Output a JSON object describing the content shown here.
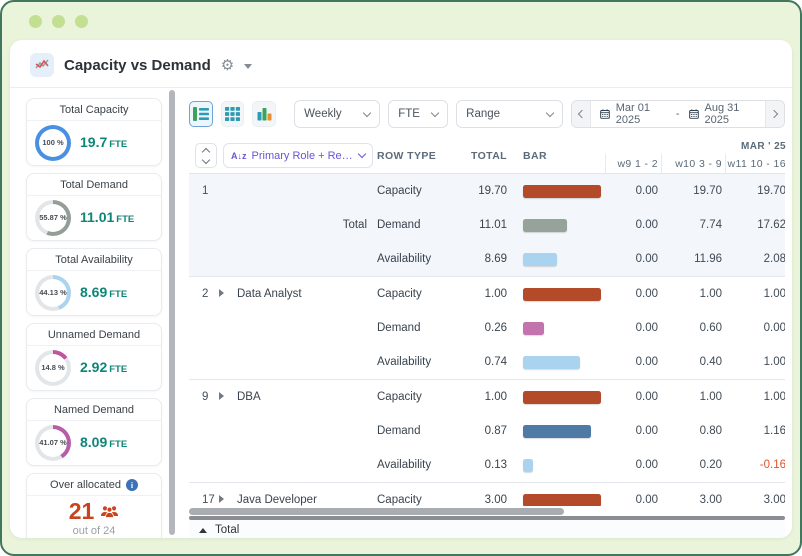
{
  "window": {
    "title": "Capacity vs Demand"
  },
  "sidebar": {
    "cards": [
      {
        "label": "Total Capacity",
        "pct": "100 %",
        "pct_value": 100,
        "value": "19.7",
        "unit": "FTE",
        "ring_color": "#4a90e2"
      },
      {
        "label": "Total Demand",
        "pct": "55.87 %",
        "pct_value": 55.87,
        "value": "11.01",
        "unit": "FTE",
        "ring_color": "#939e97"
      },
      {
        "label": "Total Availability",
        "pct": "44.13 %",
        "pct_value": 44.13,
        "value": "8.69",
        "unit": "FTE",
        "ring_color": "#a9d3ee"
      },
      {
        "label": "Unnamed Demand",
        "pct": "14.8 %",
        "pct_value": 14.8,
        "value": "2.92",
        "unit": "FTE",
        "ring_color": "#c0559e"
      },
      {
        "label": "Named Demand",
        "pct": "41.07 %",
        "pct_value": 41.07,
        "value": "8.09",
        "unit": "FTE",
        "ring_color": "#b55fa9"
      }
    ],
    "over_allocated": {
      "label": "Over allocated",
      "count": "21",
      "sub": "out of 24",
      "accent": "#c8441c"
    }
  },
  "toolbar": {
    "views": [
      "board-view",
      "grid-view",
      "chart-view"
    ],
    "selected_view": 0,
    "selects": [
      {
        "name": "interval",
        "value": "Weekly"
      },
      {
        "name": "unit",
        "value": "FTE"
      },
      {
        "name": "range",
        "value": "Range"
      }
    ],
    "date_range": {
      "start": "Mar 01 2025",
      "separator": "-",
      "end": "Aug 31 2025"
    }
  },
  "table": {
    "group_by": "Primary Role + Resource...",
    "sort_icon": "A↓z",
    "columns": {
      "row_type": "ROW TYPE",
      "total": "TOTAL",
      "bar": "BAR"
    },
    "month_header": "MAR ' 25",
    "week_headers": [
      "w9 1 - 2",
      "w10 3 - 9",
      "w11 10 - 16"
    ],
    "groups": [
      {
        "index": "1",
        "name": "Total",
        "name_position": "middle-right",
        "expandable": false,
        "highlight": true,
        "rows": [
          {
            "type": "Capacity",
            "total": "19.70",
            "bar_pct": 100,
            "bar_color": "#b34a2a",
            "weeks": [
              "0.00",
              "19.70",
              "19.70"
            ]
          },
          {
            "type": "Demand",
            "total": "11.01",
            "bar_pct": 56,
            "bar_color": "#95a39a",
            "weeks": [
              "0.00",
              "7.74",
              "17.62"
            ]
          },
          {
            "type": "Availability",
            "total": "8.69",
            "bar_pct": 44,
            "bar_color": "#a9d3ee",
            "weeks": [
              "0.00",
              "11.96",
              "2.08"
            ]
          }
        ]
      },
      {
        "index": "2",
        "name": "Data Analyst",
        "name_position": "top-left",
        "expandable": true,
        "highlight": false,
        "rows": [
          {
            "type": "Capacity",
            "total": "1.00",
            "bar_pct": 100,
            "bar_color": "#b34a2a",
            "weeks": [
              "0.00",
              "1.00",
              "1.00"
            ]
          },
          {
            "type": "Demand",
            "total": "0.26",
            "bar_pct": 27,
            "bar_color": "#c373ae",
            "weeks": [
              "0.00",
              "0.60",
              "0.00"
            ]
          },
          {
            "type": "Availability",
            "total": "0.74",
            "bar_pct": 73,
            "bar_color": "#a9d3ee",
            "weeks": [
              "0.00",
              "0.40",
              "1.00"
            ]
          }
        ]
      },
      {
        "index": "9",
        "name": "DBA",
        "name_position": "top-left",
        "expandable": true,
        "highlight": false,
        "rows": [
          {
            "type": "Capacity",
            "total": "1.00",
            "bar_pct": 100,
            "bar_color": "#b34a2a",
            "weeks": [
              "0.00",
              "1.00",
              "1.00"
            ]
          },
          {
            "type": "Demand",
            "total": "0.87",
            "bar_pct": 87,
            "bar_color": "#4f7aa5",
            "weeks": [
              "0.00",
              "0.80",
              "1.16"
            ]
          },
          {
            "type": "Availability",
            "total": "0.13",
            "bar_pct": 13,
            "bar_color": "#a9d3ee",
            "weeks": [
              "0.00",
              "0.20",
              "-0.16"
            ]
          }
        ]
      },
      {
        "index": "17",
        "name": "Java Developer",
        "name_position": "top-left",
        "expandable": true,
        "highlight": false,
        "rows": [
          {
            "type": "Capacity",
            "total": "3.00",
            "bar_pct": 100,
            "bar_color": "#b34a2a",
            "weeks": [
              "0.00",
              "3.00",
              "3.00"
            ]
          }
        ]
      }
    ],
    "footer": {
      "label": "Total"
    }
  }
}
